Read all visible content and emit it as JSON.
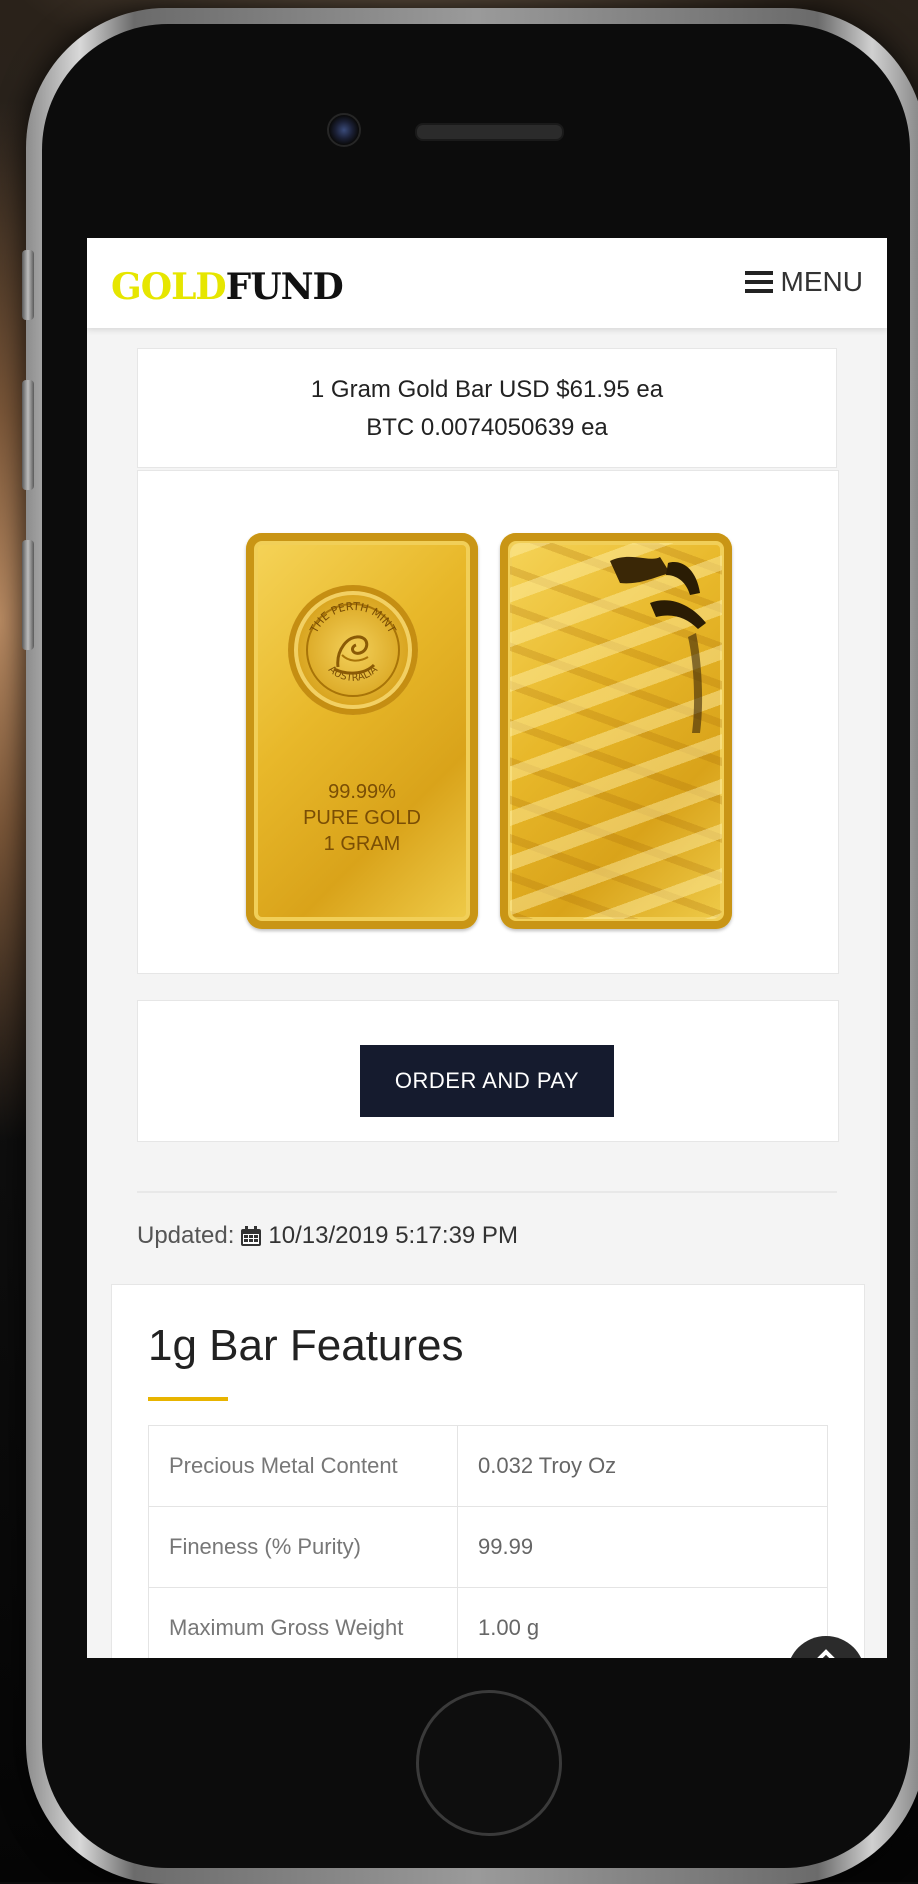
{
  "header": {
    "logo_gold": "GOLD",
    "logo_fund": "FUND",
    "menu_label": "MENU"
  },
  "product": {
    "price_line_usd": "1 Gram Gold Bar USD $61.95 ea",
    "price_line_btc": "BTC 0.0074050639 ea",
    "bar_front_seal_top": "THE PERTH MINT",
    "bar_front_seal_bottom": "AUSTRALIA",
    "bar_front_text": [
      "99.99%",
      "PURE GOLD",
      "1 GRAM"
    ]
  },
  "order_button_label": "ORDER AND PAY",
  "updated": {
    "label": "Updated:",
    "datetime": "10/13/2019 5:17:39 PM"
  },
  "features": {
    "title": "1g Bar Features",
    "rows": [
      {
        "key": "Precious Metal Content",
        "value": "0.032 Troy Oz"
      },
      {
        "key": "Fineness (% Purity)",
        "value": "99.99"
      },
      {
        "key": "Maximum Gross Weight",
        "value": "1.00 g"
      }
    ]
  },
  "colors": {
    "logo_gold": "#e6e600",
    "button_bg": "#151b2e",
    "accent_underline": "#e8b400"
  },
  "icons": {
    "menu": "hamburger-icon",
    "calendar": "calendar-icon",
    "scroll_top": "chevron-up-icon"
  }
}
